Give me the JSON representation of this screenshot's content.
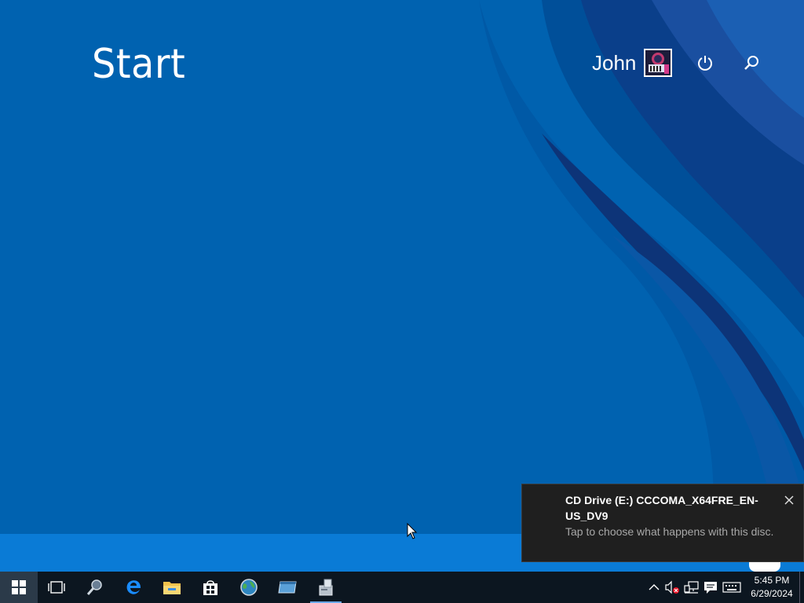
{
  "start_screen": {
    "title": "Start",
    "user_name": "John"
  },
  "notification": {
    "title": "CD Drive (E:) CCCOMA_X64FRE_EN-US_DV9",
    "body": "Tap to choose what happens with this disc."
  },
  "taskbar": {
    "pinned": [
      {
        "name": "start-button",
        "icon": "windows-logo-icon"
      },
      {
        "name": "task-view-button",
        "icon": "task-view-icon"
      },
      {
        "name": "search-button",
        "icon": "magnifier-icon"
      },
      {
        "name": "edge-button",
        "icon": "edge-icon"
      },
      {
        "name": "file-explorer-button",
        "icon": "folder-icon"
      },
      {
        "name": "store-button",
        "icon": "store-bag-icon"
      },
      {
        "name": "app-globe-button",
        "icon": "globe-icon"
      },
      {
        "name": "app-window-button",
        "icon": "window-icon"
      },
      {
        "name": "app-installer-button",
        "icon": "installer-icon"
      }
    ],
    "clock": {
      "time": "5:45 PM",
      "date": "6/29/2024"
    }
  },
  "colors": {
    "desktop_blue": "#0062b0",
    "strip_blue": "#0a7bd6",
    "taskbar": "#0c1620",
    "toast_bg": "#1f1f1f"
  }
}
